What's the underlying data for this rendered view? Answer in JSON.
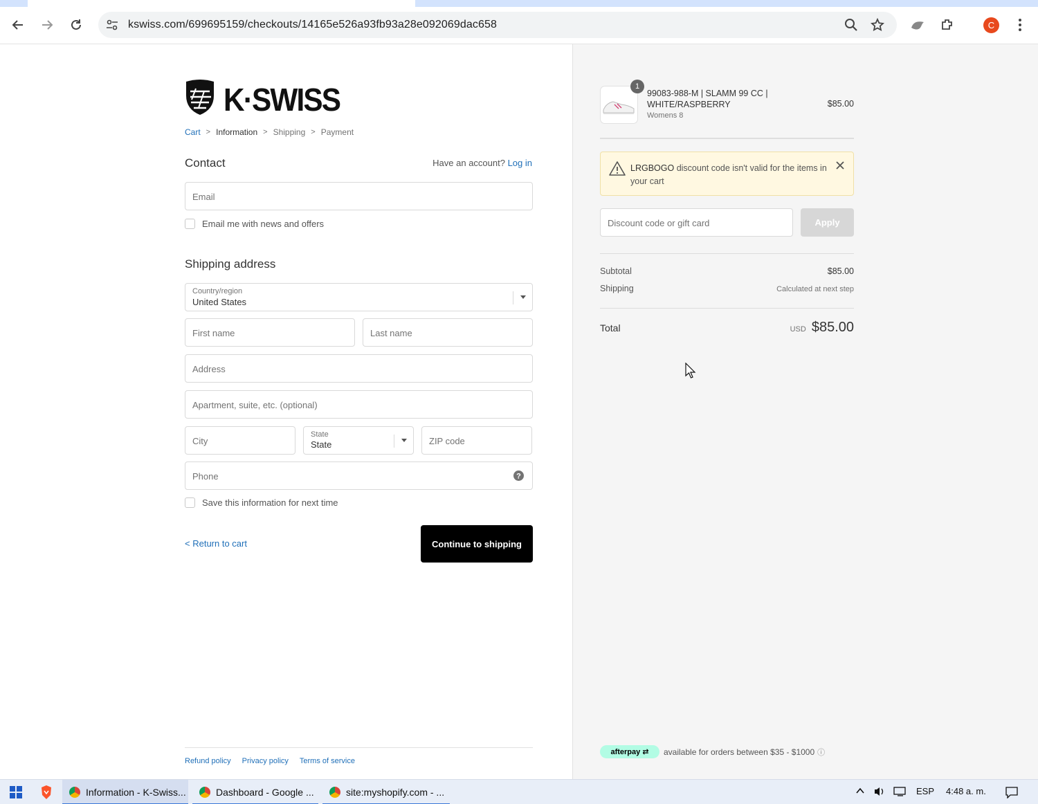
{
  "browser": {
    "url": "kswiss.com/699695159/checkouts/14165e526a93fb93a28e092069dac658",
    "profile_initial": "C"
  },
  "brand": {
    "logo_text": "K·SWISS",
    "accent": "#000000",
    "link_color": "#1f6fb8"
  },
  "breadcrumb": {
    "cart": "Cart",
    "information": "Information",
    "shipping": "Shipping",
    "payment": "Payment"
  },
  "contact": {
    "title": "Contact",
    "have_account": "Have an account?",
    "login": "Log in",
    "email_placeholder": "Email",
    "newsletter_label": "Email me with news and offers"
  },
  "shipping_address": {
    "title": "Shipping address",
    "country_label": "Country/region",
    "country_value": "United States",
    "first_name_placeholder": "First name",
    "last_name_placeholder": "Last name",
    "address_placeholder": "Address",
    "apartment_placeholder": "Apartment, suite, etc. (optional)",
    "city_placeholder": "City",
    "state_label": "State",
    "state_value": "State",
    "zip_placeholder": "ZIP code",
    "phone_placeholder": "Phone",
    "save_info_label": "Save this information for next time"
  },
  "actions": {
    "return_to_cart": "Return to cart",
    "continue": "Continue to shipping"
  },
  "footer": {
    "refund": "Refund policy",
    "privacy": "Privacy policy",
    "terms": "Terms of service"
  },
  "order": {
    "item": {
      "quantity": "1",
      "name": "99083-988-M | SLAMM 99 CC | WHITE/RASPBERRY",
      "variant": "Womens 8",
      "price": "$85.00"
    },
    "warning": {
      "code": "LRGBOGO",
      "message": "discount code isn't valid for the items in your cart"
    },
    "discount_placeholder": "Discount code or gift card",
    "apply_label": "Apply",
    "subtotal_label": "Subtotal",
    "subtotal_value": "$85.00",
    "shipping_label": "Shipping",
    "shipping_value": "Calculated at next step",
    "total_label": "Total",
    "total_currency": "USD",
    "total_value": "$85.00",
    "afterpay_badge": "afterpay",
    "afterpay_text": "available for orders between $35 - $1000"
  },
  "taskbar": {
    "tabs": [
      "Information - K-Swiss...",
      "Dashboard - Google ...",
      "site:myshopify.com - ..."
    ],
    "language": "ESP",
    "time": "4:48 a. m."
  }
}
